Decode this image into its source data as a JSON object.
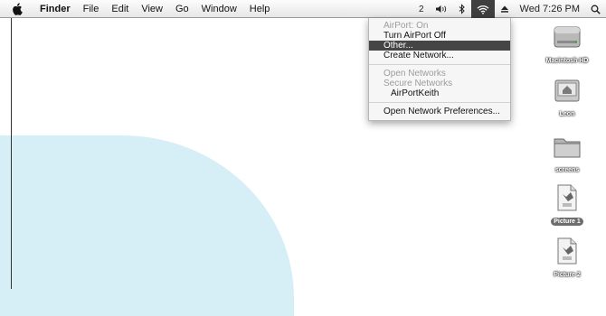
{
  "menubar": {
    "apple_icon": "apple-icon",
    "app_name": "Finder",
    "menus": [
      "File",
      "Edit",
      "View",
      "Go",
      "Window",
      "Help"
    ],
    "status": {
      "spaces": "2",
      "volume_icon": "volume-icon",
      "bluetooth_icon": "bluetooth-icon",
      "airport_icon": "wifi-icon",
      "eject_icon": "eject-icon",
      "clock": "Wed 7:26 PM",
      "spotlight_icon": "magnifier-icon"
    }
  },
  "airport_menu": {
    "status": "AirPort: On",
    "turn_off": "Turn AirPort Off",
    "other": "Other...",
    "create_network": "Create Network...",
    "open_networks": "Open Networks",
    "secure_networks": "Secure Networks",
    "network_1": "AirPortKeith",
    "preferences": "Open Network Preferences..."
  },
  "desktop": {
    "icons": [
      {
        "label": "Macintosh HD",
        "type": "harddisk-icon",
        "selected": false
      },
      {
        "label": "Leon",
        "type": "home-folder-icon",
        "selected": false
      },
      {
        "label": "screens",
        "type": "folder-icon",
        "selected": false
      },
      {
        "label": "Picture 1",
        "type": "image-file-icon",
        "selected": true
      },
      {
        "label": "Picture 2",
        "type": "image-file-icon",
        "selected": false
      }
    ]
  },
  "colors": {
    "menu_highlight": "#454545",
    "desktop_shape": "#d6eef5"
  }
}
